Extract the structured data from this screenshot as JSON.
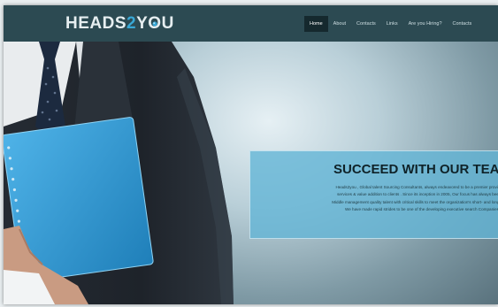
{
  "header": {
    "logo": {
      "part1": "HEADS",
      "part2": "2",
      "part3": "Y",
      "part4": "O",
      "part5": "U"
    },
    "nav": [
      {
        "label": "Home",
        "active": true
      },
      {
        "label": "About",
        "active": false
      },
      {
        "label": "Contacts",
        "active": false
      },
      {
        "label": "Links",
        "active": false
      },
      {
        "label": "Are you Hiring?",
        "active": false
      },
      {
        "label": "Contacts",
        "active": false
      }
    ]
  },
  "hero": {
    "title": "SUCCEED WITH OUR TEA",
    "lines": [
      "Heads2you , Global talent Sourcing Consultants, always endeavored to be a premier provider of",
      "services & value addition to clients . Since its inception in 2005, Our focus has always been on",
      "Middle management quality talent with critical skills to meet the organization's short- and long-term s",
      "We have made rapid strides to be one of the developing executive search Companies"
    ]
  },
  "colors": {
    "header_bg": "#2c4a52",
    "nav_active_bg": "#15292e",
    "accent": "#39a8d6",
    "panel_bg": "#62b5d6",
    "title_text": "#0f2228"
  }
}
